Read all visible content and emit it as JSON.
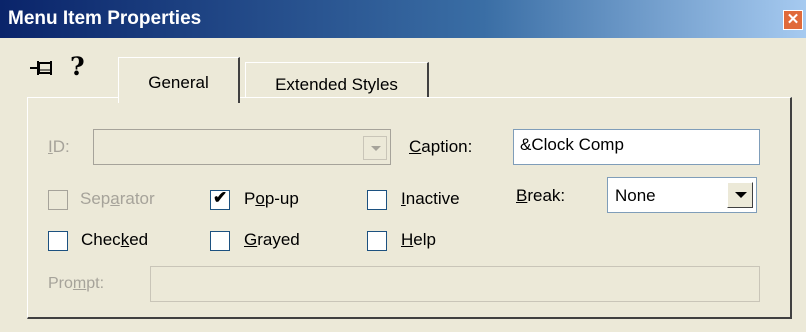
{
  "window": {
    "title": "Menu Item Properties",
    "close_label": "✕"
  },
  "toolbar": {
    "pin_icon": "pushpin-icon",
    "help_glyph": "?"
  },
  "tabs": [
    {
      "label": "General",
      "selected": true
    },
    {
      "label": "Extended Styles",
      "selected": false
    }
  ],
  "general": {
    "id": {
      "label_accel": "I",
      "label_rest": "D:",
      "value": ""
    },
    "caption": {
      "label_accel": "C",
      "label_rest": "aption:",
      "value": "&Clock Comp"
    },
    "separator": {
      "label_pre": "Sep",
      "label_accel": "a",
      "label_post": "rator",
      "checked": false,
      "enabled": false
    },
    "popup": {
      "label_pre": "P",
      "label_accel": "o",
      "label_post": "p-up",
      "checked": true,
      "checkmark": "✔"
    },
    "inactive": {
      "label_accel": "I",
      "label_post": "nactive",
      "checked": false
    },
    "break": {
      "label_accel": "B",
      "label_post": "reak:",
      "value": "None"
    },
    "checked": {
      "label_pre": "Chec",
      "label_accel": "k",
      "label_post": "ed",
      "checked": false
    },
    "grayed": {
      "label_accel": "G",
      "label_post": "rayed",
      "checked": false
    },
    "help": {
      "label_accel": "H",
      "label_post": "elp",
      "checked": false
    },
    "prompt": {
      "label_pre": "Pro",
      "label_accel": "m",
      "label_post": "pt:",
      "value": ""
    }
  }
}
